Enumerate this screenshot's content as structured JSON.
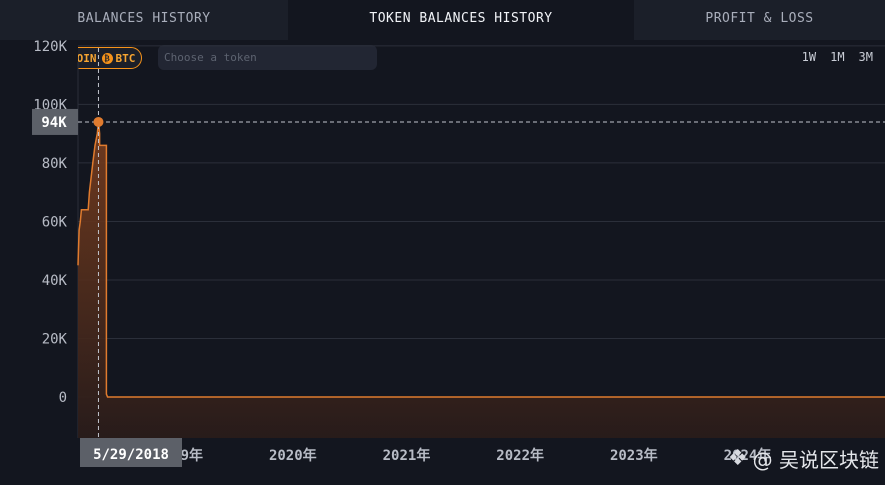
{
  "tabs": [
    {
      "label": "BALANCES HISTORY",
      "active": false
    },
    {
      "label": "TOKEN BALANCES HISTORY",
      "active": true
    },
    {
      "label": "PROFIT & LOSS",
      "active": false
    }
  ],
  "toolbar": {
    "coin_label": "COIN",
    "btc_symbol": "₿",
    "btc_label": "BTC",
    "token_placeholder": "Choose a token",
    "ranges": [
      "1W",
      "1M",
      "3M"
    ]
  },
  "colors": {
    "accent": "#f7931a",
    "line": "#e07b2e",
    "fill_top": "#7a3e1e",
    "fill_bottom": "#2a1c1a",
    "grid": "#2b2f3a"
  },
  "chart_data": {
    "type": "area",
    "y_ticks": [
      "120K",
      "100K",
      "80K",
      "60K",
      "40K",
      "20K",
      "0"
    ],
    "y_tick_values": [
      120000,
      100000,
      80000,
      60000,
      40000,
      20000,
      0
    ],
    "ylim": [
      -14000,
      122000
    ],
    "x_ticks": [
      "2020年",
      "2021年",
      "2022年",
      "2023年",
      "2024年"
    ],
    "x_tick_values": [
      2020.0,
      2021.0,
      2022.0,
      2023.0,
      2024.0
    ],
    "xlim": [
      2018.11,
      2025.21
    ],
    "series": [
      {
        "x": [
          2018.11,
          2018.12,
          2018.13,
          2018.14,
          2018.2,
          2018.21,
          2018.24,
          2018.26,
          2018.28,
          2018.29,
          2018.3,
          2018.3,
          2018.36,
          2018.36,
          2018.37,
          2025.21
        ],
        "y": [
          45000,
          57000,
          60000,
          64000,
          64000,
          70000,
          80000,
          86000,
          90000,
          94000,
          90000,
          86000,
          86000,
          1000,
          0,
          0
        ]
      }
    ],
    "crosshair": {
      "value_label": "94K",
      "value": 94000,
      "date_label": "5/29/2018",
      "date_x": 2018.29
    }
  },
  "watermark": {
    "text": "@ 吴说区块链"
  }
}
